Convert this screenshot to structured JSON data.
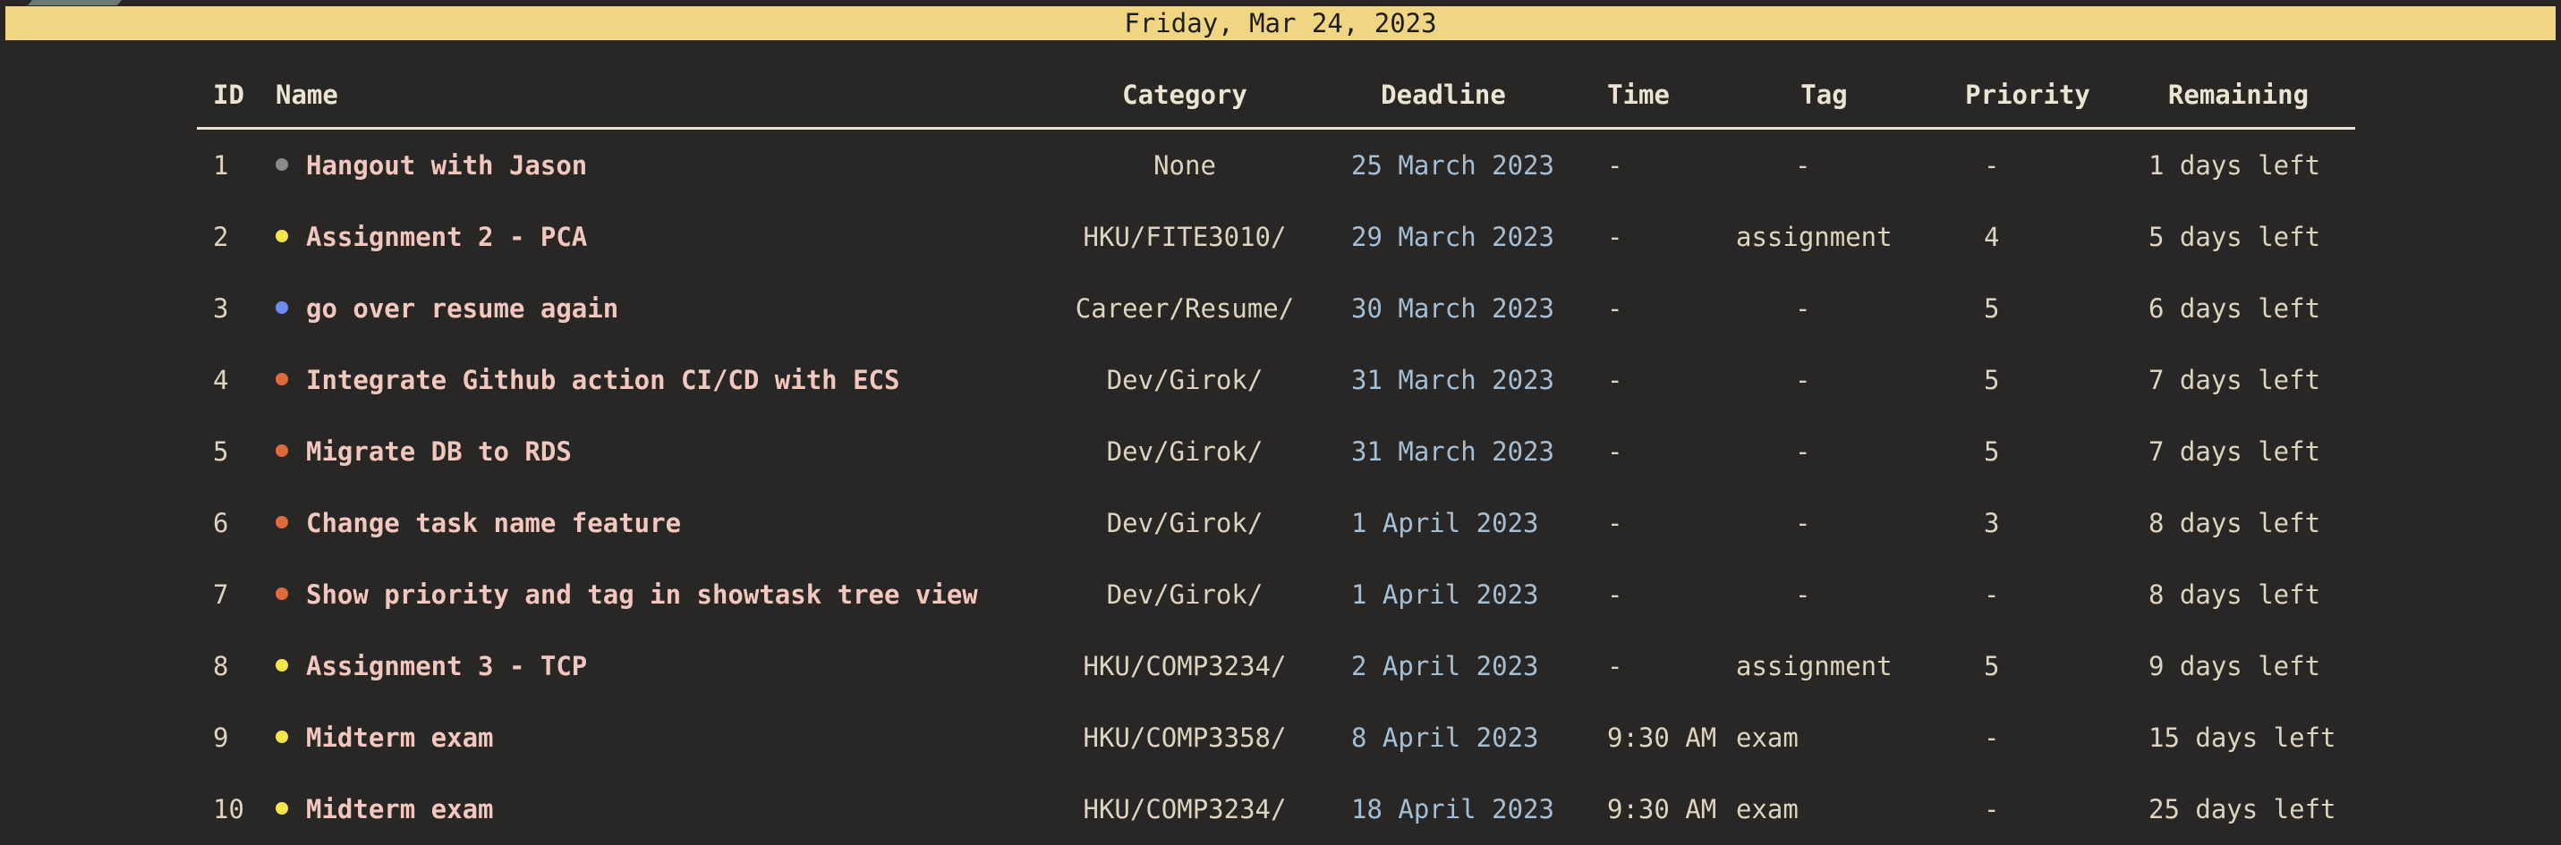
{
  "date_header": "Friday, Mar 24, 2023",
  "columns": {
    "id": "ID",
    "name": "Name",
    "category": "Category",
    "deadline": "Deadline",
    "time": "Time",
    "tag": "Tag",
    "priority": "Priority",
    "remaining": "Remaining"
  },
  "colors": {
    "header_bar": "#f0d582",
    "background": "#282726",
    "task_name": "#f2c7bd",
    "deadline": "#a4bed4",
    "dot_gray": "#8a8a8a",
    "dot_yellow": "#f4e44a",
    "dot_blue": "#6b8cf0",
    "dot_orange": "#e0683a"
  },
  "rows": [
    {
      "id": "1",
      "dot": "#8a8a8a",
      "name": "Hangout with Jason",
      "category": "None",
      "deadline": "25 March 2023",
      "time": "-",
      "tag": "-",
      "priority": "-",
      "remaining": "1 days left"
    },
    {
      "id": "2",
      "dot": "#f4e44a",
      "name": "Assignment 2 - PCA",
      "category": "HKU/FITE3010/",
      "deadline": "29 March 2023",
      "time": "-",
      "tag": "assignment",
      "priority": "4",
      "remaining": "5 days left"
    },
    {
      "id": "3",
      "dot": "#6b8cf0",
      "name": "go over resume again",
      "category": "Career/Resume/",
      "deadline": "30 March 2023",
      "time": "-",
      "tag": "-",
      "priority": "5",
      "remaining": "6 days left"
    },
    {
      "id": "4",
      "dot": "#e0683a",
      "name": "Integrate Github action CI/CD with ECS",
      "category": "Dev/Girok/",
      "deadline": "31 March 2023",
      "time": "-",
      "tag": "-",
      "priority": "5",
      "remaining": "7 days left"
    },
    {
      "id": "5",
      "dot": "#e0683a",
      "name": "Migrate DB to RDS",
      "category": "Dev/Girok/",
      "deadline": "31 March 2023",
      "time": "-",
      "tag": "-",
      "priority": "5",
      "remaining": "7 days left"
    },
    {
      "id": "6",
      "dot": "#e0683a",
      "name": "Change task name feature",
      "category": "Dev/Girok/",
      "deadline": "1 April 2023",
      "time": "-",
      "tag": "-",
      "priority": "3",
      "remaining": "8 days left"
    },
    {
      "id": "7",
      "dot": "#e0683a",
      "name": "Show priority and tag in showtask tree view",
      "category": "Dev/Girok/",
      "deadline": "1 April 2023",
      "time": "-",
      "tag": "-",
      "priority": "-",
      "remaining": "8 days left"
    },
    {
      "id": "8",
      "dot": "#f4e44a",
      "name": "Assignment 3 - TCP",
      "category": "HKU/COMP3234/",
      "deadline": "2 April 2023",
      "time": "-",
      "tag": "assignment",
      "priority": "5",
      "remaining": "9 days left"
    },
    {
      "id": "9",
      "dot": "#f4e44a",
      "name": "Midterm exam",
      "category": "HKU/COMP3358/",
      "deadline": "8 April 2023",
      "time": "9:30 AM",
      "tag": "exam",
      "priority": "-",
      "remaining": "15 days left"
    },
    {
      "id": "10",
      "dot": "#f4e44a",
      "name": "Midterm exam",
      "category": "HKU/COMP3234/",
      "deadline": "18 April 2023",
      "time": "9:30 AM",
      "tag": "exam",
      "priority": "-",
      "remaining": "25 days left"
    }
  ]
}
